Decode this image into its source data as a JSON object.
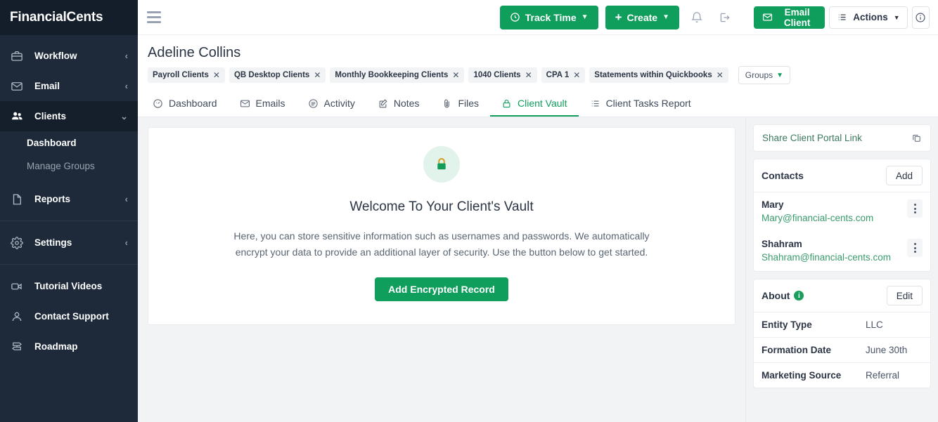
{
  "brand": {
    "name": "FinancialCents"
  },
  "sidebar": {
    "items": [
      {
        "label": "Workflow",
        "icon": "briefcase-icon",
        "caret": "‹",
        "active": false
      },
      {
        "label": "Email",
        "icon": "envelope-icon",
        "caret": "‹",
        "active": false
      },
      {
        "label": "Clients",
        "icon": "users-icon",
        "caret": "⌄",
        "active": true
      }
    ],
    "clients_sub": [
      {
        "label": "Dashboard",
        "active": true
      },
      {
        "label": "Manage Groups",
        "active": false
      }
    ],
    "reports": {
      "label": "Reports",
      "icon": "document-icon",
      "caret": "‹"
    },
    "settings": {
      "label": "Settings",
      "icon": "gear-icon",
      "caret": "‹"
    },
    "footer_items": [
      {
        "label": "Tutorial Videos",
        "icon": "video-camera-icon"
      },
      {
        "label": "Contact Support",
        "icon": "person-icon"
      },
      {
        "label": "Roadmap",
        "icon": "signpost-icon"
      }
    ]
  },
  "topbar": {
    "track_time_label": "Track Time",
    "create_label": "Create",
    "notification_icon": "bell-icon",
    "logout_icon": "logout-icon"
  },
  "client": {
    "name": "Adeline Collins",
    "tags": [
      "Payroll Clients",
      "QB Desktop Clients",
      "Monthly Bookkeeping Clients",
      "1040 Clients",
      "CPA 1",
      "Statements within Quickbooks"
    ],
    "groups_button": "Groups"
  },
  "tabs": [
    {
      "label": "Dashboard",
      "icon": "gauge-icon",
      "active": false
    },
    {
      "label": "Emails",
      "icon": "envelope-icon",
      "active": false
    },
    {
      "label": "Activity",
      "icon": "list-circle-icon",
      "active": false
    },
    {
      "label": "Notes",
      "icon": "note-edit-icon",
      "active": false
    },
    {
      "label": "Files",
      "icon": "paperclip-icon",
      "active": false
    },
    {
      "label": "Client Vault",
      "icon": "lock-icon",
      "active": true
    },
    {
      "label": "Client Tasks Report",
      "icon": "list-icon",
      "active": false
    }
  ],
  "vault": {
    "icon": "lock-icon",
    "title": "Welcome To Your Client's Vault",
    "description": "Here, you can store sensitive information such as usernames and passwords. We automatically encrypt your data to provide an additional layer of security. Use the button below to get started.",
    "button": "Add Encrypted Record"
  },
  "right_panel": {
    "email_client_label": "Email Client",
    "actions_label": "Actions",
    "info_icon": "info-circle-icon",
    "share_link_label": "Share Client Portal Link",
    "copy_icon": "copy-icon",
    "contacts": {
      "title": "Contacts",
      "add_label": "Add",
      "people": [
        {
          "name": "Mary",
          "email": "Mary@financial-cents.com"
        },
        {
          "name": "Shahram",
          "email": "Shahram@financial-cents.com"
        }
      ]
    },
    "about": {
      "title": "About",
      "edit_label": "Edit",
      "rows": [
        {
          "key": "Entity Type",
          "value": "LLC"
        },
        {
          "key": "Formation Date",
          "value": "June 30th"
        },
        {
          "key": "Marketing Source",
          "value": "Referral"
        }
      ]
    }
  },
  "colors": {
    "brand_green": "#109e5c",
    "sidebar_bg": "#1e2a3a",
    "sidebar_brand_bg": "#141e2b",
    "page_bg": "#f2f3f5",
    "link_green": "#3a9c6d"
  }
}
